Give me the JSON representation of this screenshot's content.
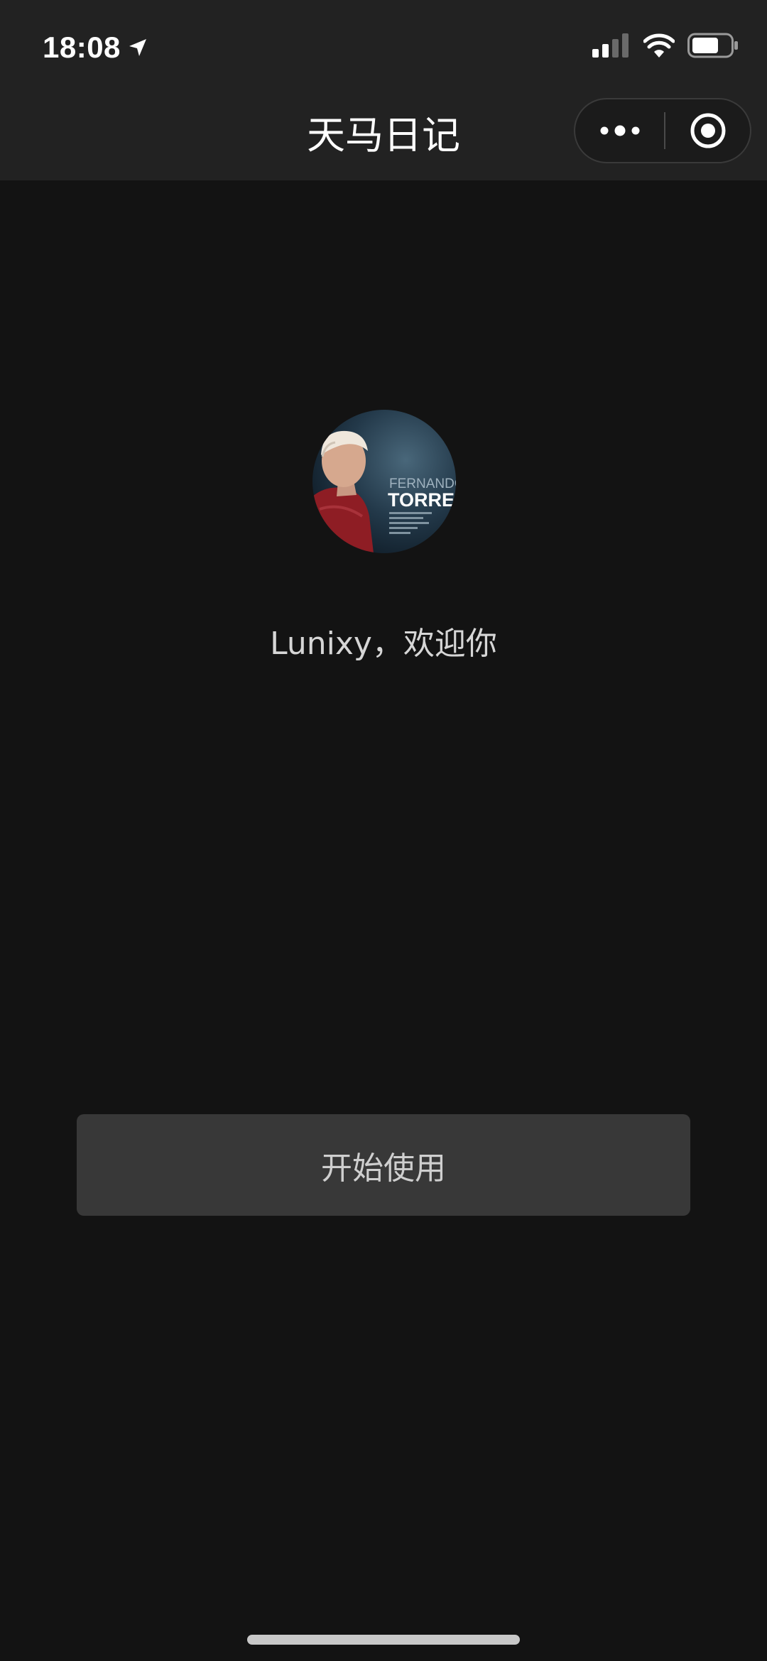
{
  "status_bar": {
    "time": "18:08",
    "location_icon": "location-arrow-icon",
    "signal_icon": "cellular-signal-icon",
    "wifi_icon": "wifi-icon",
    "battery_icon": "battery-icon"
  },
  "nav": {
    "title": "天马日记",
    "more_icon": "more-dots-icon",
    "close_icon": "mini-program-close-icon"
  },
  "profile": {
    "avatar_text_line1": "FERNANDO",
    "avatar_text_line2": "TORRES",
    "welcome": "Lunixy，欢迎你"
  },
  "actions": {
    "start_label": "开始使用"
  },
  "colors": {
    "background": "#131313",
    "topbar": "#222222",
    "button": "#383838",
    "button_text": "#cfcfcf",
    "welcome_text": "#d6d6d6"
  }
}
